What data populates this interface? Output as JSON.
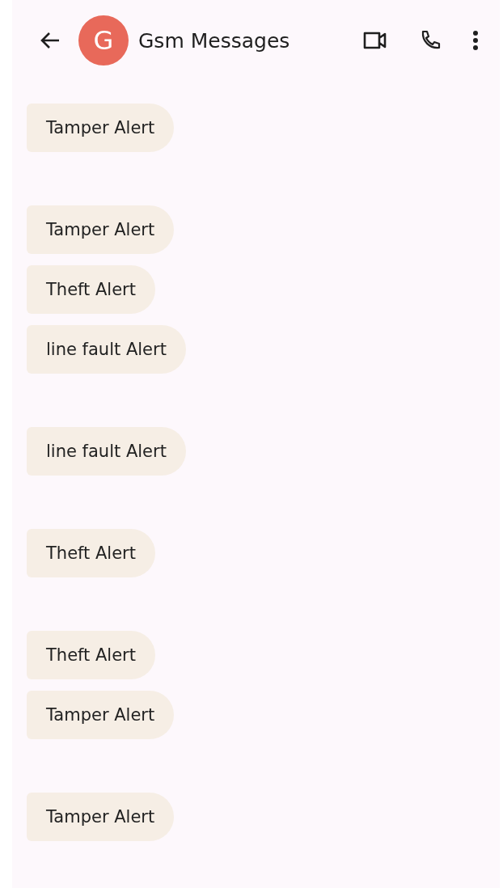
{
  "header": {
    "avatar_letter": "G",
    "title": "Gsm Messages"
  },
  "message_groups": [
    {
      "messages": [
        "Tamper Alert"
      ]
    },
    {
      "messages": [
        "Tamper Alert",
        "Theft Alert",
        "line fault Alert"
      ]
    },
    {
      "messages": [
        "line fault Alert"
      ]
    },
    {
      "messages": [
        "Theft Alert"
      ]
    },
    {
      "messages": [
        "Theft Alert",
        "Tamper Alert"
      ]
    },
    {
      "messages": [
        "Tamper Alert"
      ]
    }
  ]
}
